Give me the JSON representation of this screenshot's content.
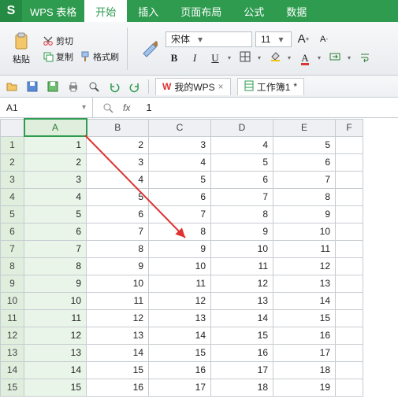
{
  "app": {
    "logo": "S",
    "name": "WPS 表格"
  },
  "menu": {
    "start": "开始",
    "insert": "插入",
    "pagelayout": "页面布局",
    "formulas": "公式",
    "data": "数据"
  },
  "ribbon": {
    "paste": "粘贴",
    "cut": "剪切",
    "copy": "复制",
    "formatpainter": "格式刷",
    "font_name": "宋体",
    "font_size": "11",
    "bold": "B",
    "italic": "I",
    "underline": "U",
    "increaseA": "A",
    "decreaseA": "A",
    "fontcolorA": "A"
  },
  "quick": {
    "mywps": "我的WPS",
    "workbook": "工作簿1",
    "dirty": "*"
  },
  "formula": {
    "namebox": "A1",
    "fx": "fx",
    "value": "1"
  },
  "cols": [
    "A",
    "B",
    "C",
    "D",
    "E",
    "F"
  ],
  "selectedColIndex": 0,
  "rows": [
    {
      "r": 1,
      "v": [
        1,
        2,
        3,
        4,
        5
      ]
    },
    {
      "r": 2,
      "v": [
        2,
        3,
        4,
        5,
        6
      ]
    },
    {
      "r": 3,
      "v": [
        3,
        4,
        5,
        6,
        7
      ]
    },
    {
      "r": 4,
      "v": [
        4,
        5,
        6,
        7,
        8
      ]
    },
    {
      "r": 5,
      "v": [
        5,
        6,
        7,
        8,
        9
      ]
    },
    {
      "r": 6,
      "v": [
        6,
        7,
        8,
        9,
        10
      ]
    },
    {
      "r": 7,
      "v": [
        7,
        8,
        9,
        10,
        11
      ]
    },
    {
      "r": 8,
      "v": [
        8,
        9,
        10,
        11,
        12
      ]
    },
    {
      "r": 9,
      "v": [
        9,
        10,
        11,
        12,
        13
      ]
    },
    {
      "r": 10,
      "v": [
        10,
        11,
        12,
        13,
        14
      ]
    },
    {
      "r": 11,
      "v": [
        11,
        12,
        13,
        14,
        15
      ]
    },
    {
      "r": 12,
      "v": [
        12,
        13,
        14,
        15,
        16
      ]
    },
    {
      "r": 13,
      "v": [
        13,
        14,
        15,
        16,
        17
      ]
    },
    {
      "r": 14,
      "v": [
        14,
        15,
        16,
        17,
        18
      ]
    },
    {
      "r": 15,
      "v": [
        15,
        16,
        17,
        18,
        19
      ]
    }
  ]
}
